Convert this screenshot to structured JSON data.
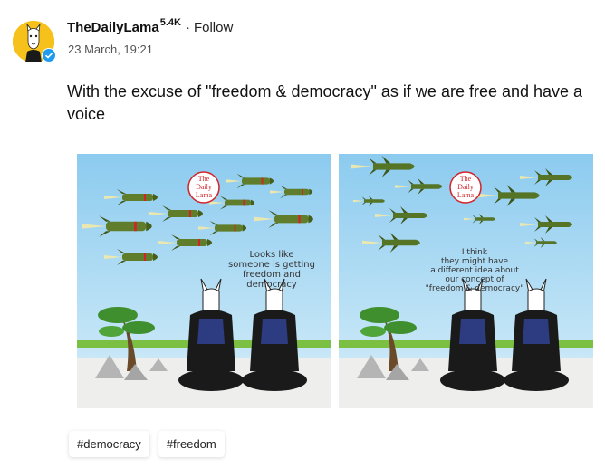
{
  "author": {
    "name": "TheDailyLama",
    "followers": "5.4K",
    "separator": "·",
    "follow_label": "Follow",
    "timestamp": "23 March, 19:21"
  },
  "post": {
    "text": "With the excuse of \"freedom & democracy\" as if we are free and have a voice"
  },
  "images": [
    {
      "logo_lines": [
        "The",
        "Daily",
        "Lama"
      ],
      "caption_lines": [
        "Looks like",
        "someone is getting",
        "freedom and",
        "democracy"
      ]
    },
    {
      "logo_lines": [
        "The",
        "Daily",
        "Lama"
      ],
      "caption_lines": [
        "I think",
        "they might have",
        "a different idea about",
        "our concept of",
        "\"freedom & democracy\""
      ]
    }
  ],
  "tags": [
    "#democracy",
    "#freedom"
  ],
  "colors": {
    "avatar_bg": "#f6c11a",
    "verified": "#1d9bf0",
    "sky": "#a9d8f2",
    "missile_green": "#5f7d2a",
    "logo_red": "#d2232a"
  }
}
